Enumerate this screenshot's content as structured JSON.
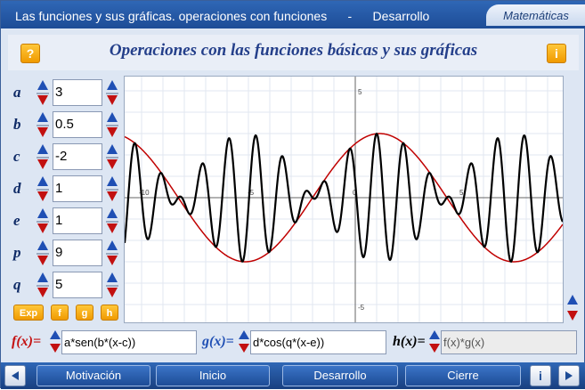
{
  "window": {
    "title": "Las funciones y sus gráficas. operaciones con funciones      -      Desarrollo",
    "subject": "Matemáticas"
  },
  "header": {
    "title": "Operaciones con las funciones básicas y sus gráficas",
    "help_label": "?",
    "info_label": "i"
  },
  "parameters": [
    {
      "label": "a",
      "value": "3"
    },
    {
      "label": "b",
      "value": "0.5"
    },
    {
      "label": "c",
      "value": "-2"
    },
    {
      "label": "d",
      "value": "1"
    },
    {
      "label": "e",
      "value": "1"
    },
    {
      "label": "p",
      "value": "9"
    },
    {
      "label": "q",
      "value": "5"
    }
  ],
  "buttons": {
    "exp": "Exp",
    "f": "f",
    "g": "g",
    "h": "h"
  },
  "formulas": {
    "f_label": "f(x)=",
    "f_value": "a*sen(b*(x-c))",
    "g_label": "g(x)=",
    "g_value": "d*cos(q*(x-e))",
    "h_label": "h(x)=",
    "h_value": "f(x)*g(x)"
  },
  "colors": {
    "f_label": "#c41010",
    "g_label": "#1f4fb4",
    "h_label": "#000000",
    "curve_f": "#c00000",
    "curve_h": "#000000"
  },
  "graph": {
    "x_ticks": [
      "-10",
      "-5",
      "0",
      "5",
      "10"
    ],
    "y_ticks": [
      "5",
      "-5"
    ]
  },
  "nav": {
    "motivacion": "Motivación",
    "inicio": "Inicio",
    "desarrollo": "Desarrollo",
    "cierre": "Cierre",
    "info": "i"
  }
}
